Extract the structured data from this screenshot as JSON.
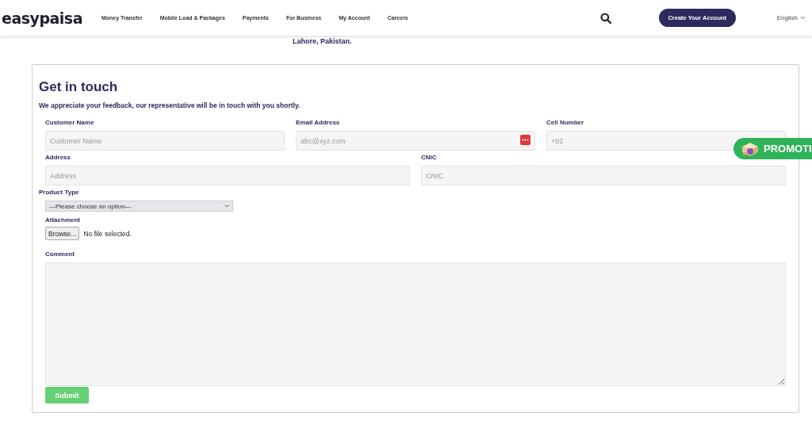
{
  "header": {
    "logo": "easypaisa",
    "nav": [
      "Money Transfer",
      "Mobile Load & Packages",
      "Payments",
      "For Business",
      "My Account",
      "Careers"
    ],
    "cta": "Create Your Account",
    "language": "English"
  },
  "address_line": "Lahore, Pakistan.",
  "form": {
    "title": "Get in touch",
    "subtitle": "We appreciate your feedback, our representative will be in touch with you shortly.",
    "row_1": [
      {
        "label": "Customer Name",
        "placeholder": "Customer Name"
      },
      {
        "label": "Email Address",
        "placeholder": "abc@xyz.com"
      },
      {
        "label": "Cell Number",
        "placeholder": "+92"
      }
    ],
    "row_2": [
      {
        "label": "Address",
        "placeholder": "Address"
      },
      {
        "label": "CNIC",
        "placeholder": "CNIC"
      }
    ],
    "product_type": {
      "label": "Product Type",
      "value": "—Please choose an option—"
    },
    "attachment": {
      "label": "Attachment",
      "button": "Browse...",
      "status": "No file selected."
    },
    "comment": {
      "label": "Comment"
    },
    "submit": "Submit"
  },
  "promo": "PROMOTI"
}
